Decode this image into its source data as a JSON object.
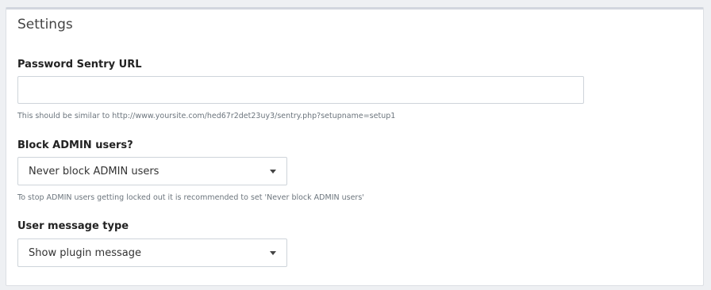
{
  "panel": {
    "title": "Settings"
  },
  "sentry_url": {
    "label": "Password Sentry URL",
    "value": "",
    "help": "This should be similar to http://www.yoursite.com/hed67r2det23uy3/sentry.php?setupname=setup1"
  },
  "block_admin": {
    "label": "Block ADMIN users?",
    "selected": "Never block ADMIN users",
    "help": "To stop ADMIN users getting locked out it is recommended to set 'Never block ADMIN users'",
    "icon": "chevron-down-icon"
  },
  "message_type": {
    "label": "User message type",
    "selected": "Show plugin message",
    "icon": "chevron-down-icon"
  }
}
